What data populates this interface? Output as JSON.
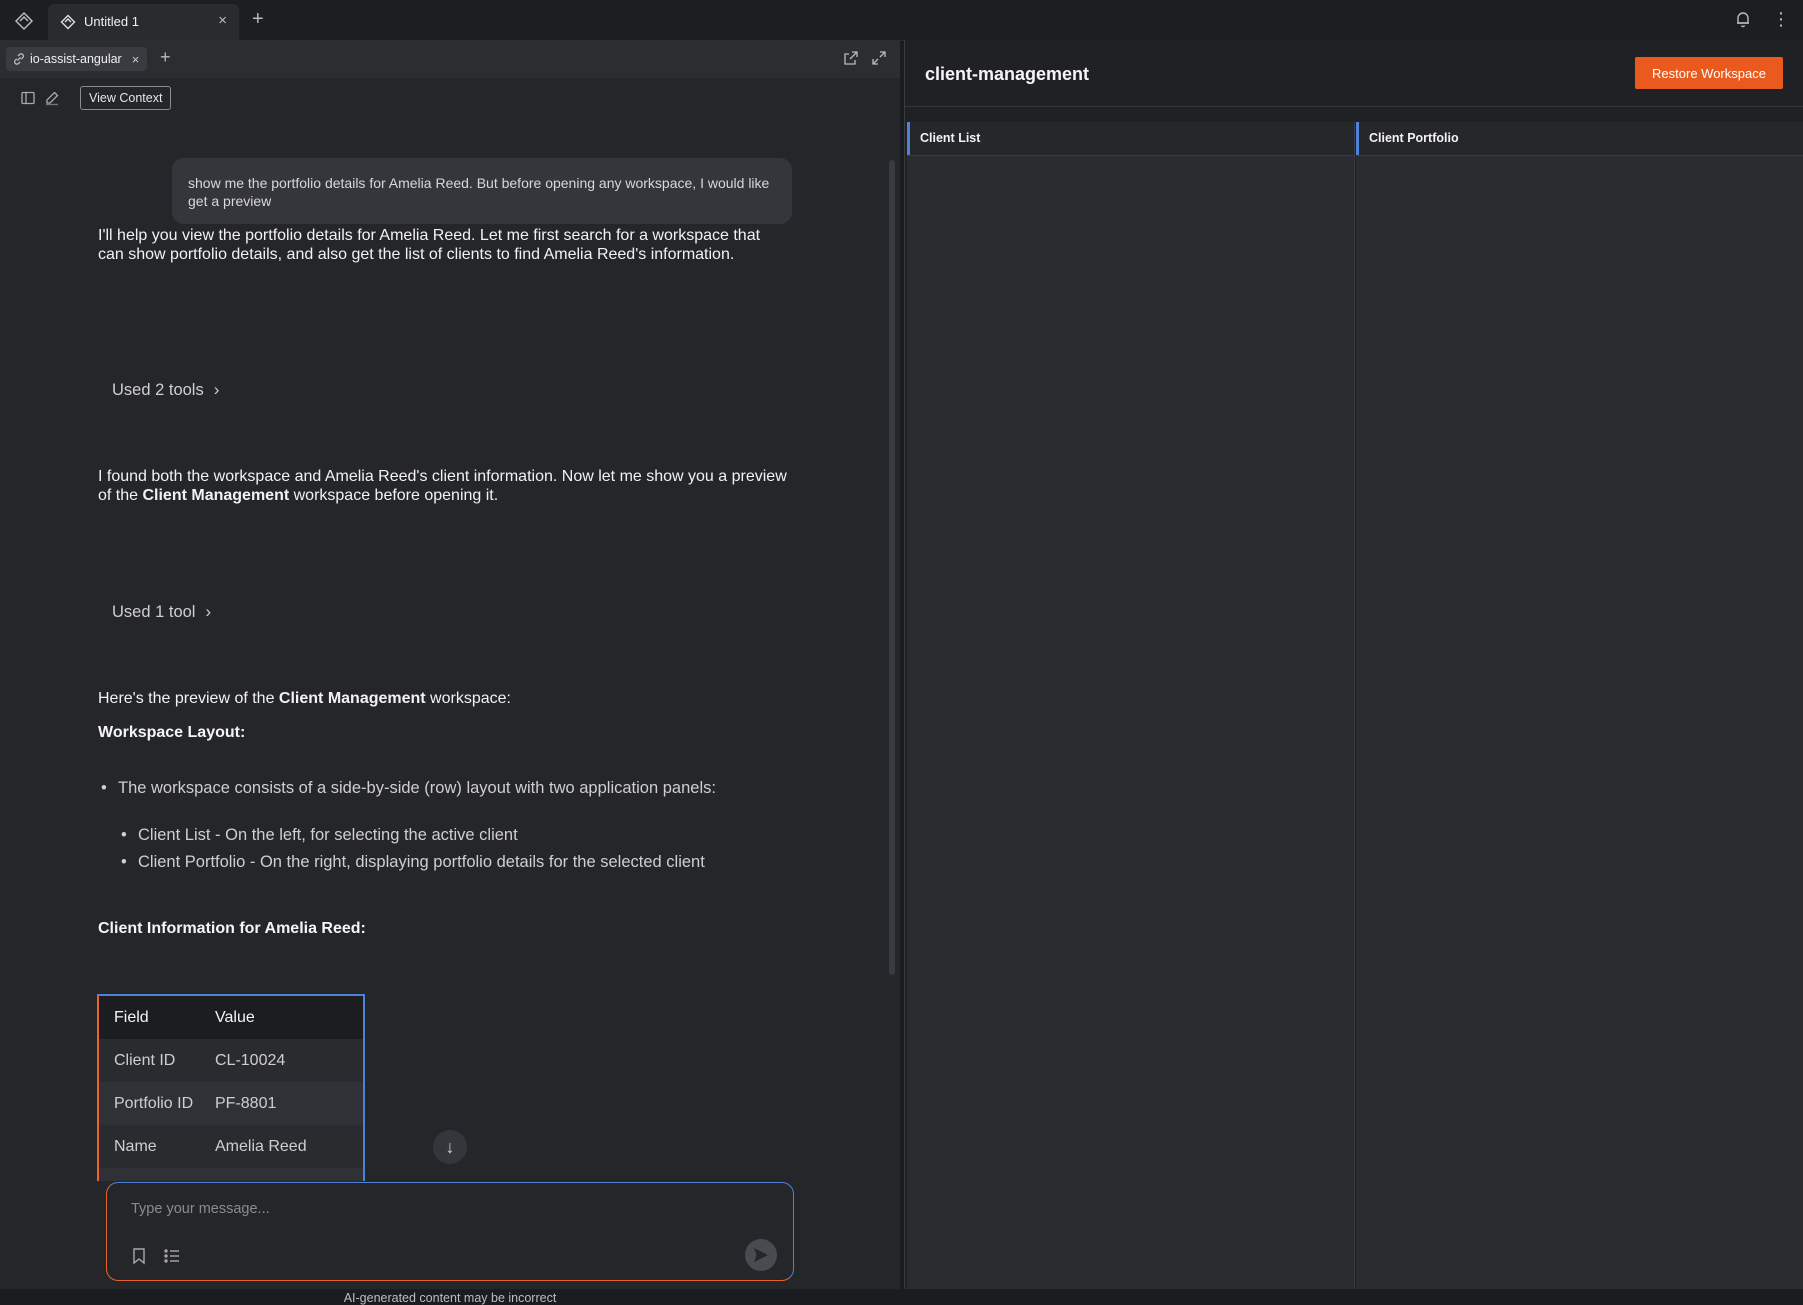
{
  "tabbar": {
    "tab_title": "Untitled 1",
    "close_glyph": "×",
    "new_tab_glyph": "+",
    "kebab_glyph": "⋮"
  },
  "chat": {
    "chip_label": "io-assist-angular",
    "chip_close": "×",
    "add_glyph": "+",
    "view_context_label": "View Context",
    "user_message": "show me the portfolio details for Amelia Reed. But before opening any workspace, I would like get a preview",
    "assistant_1": "I'll help you view the portfolio details for Amelia Reed. Let me first search for a workspace that can show portfolio details, and also get the list of clients to find Amelia Reed's information.",
    "tools_1": "Used 2 tools",
    "assistant_2_before": "I found both the workspace and Amelia Reed's client information. Now let me show you a preview of the ",
    "assistant_2_bold": "Client Management",
    "assistant_2_after": " workspace before opening it.",
    "tools_2": "Used 1 tool",
    "chevron_glyph": "›",
    "preview_before": "Here's the preview of the ",
    "preview_bold": "Client Management",
    "preview_after": " workspace:",
    "layout_heading": "Workspace Layout:",
    "bullet_main": "The workspace consists of a side-by-side (row) layout with two application panels:",
    "bullet_sub_1": "Client List - On the left, for selecting the active client",
    "bullet_sub_2": "Client Portfolio - On the right, displaying portfolio details for the selected client",
    "bullet_glyph": "•",
    "info_heading": "Client Information for Amelia Reed:",
    "table": {
      "headers": [
        "Field",
        "Value"
      ],
      "rows": [
        [
          "Client ID",
          "CL-10024"
        ],
        [
          "Portfolio ID",
          "PF-8801"
        ],
        [
          "Name",
          "Amelia Reed"
        ]
      ]
    },
    "scroll_glyph": "↓",
    "composer_placeholder": "Type your message...",
    "disclaimer": "AI-generated content may be incorrect"
  },
  "workspace": {
    "title": "client-management",
    "restore_label": "Restore Workspace",
    "panes": [
      "Client List",
      "Client Portfolio"
    ]
  },
  "colors": {
    "accent_orange": "#ea5a1f",
    "accent_blue": "#4d82d6"
  },
  "icons": [
    "app-logo-icon",
    "tab-icon",
    "bell-icon",
    "link-icon",
    "popout-icon",
    "expand-icon",
    "sidebar-toggle-icon",
    "edit-icon",
    "bookmark-icon",
    "list-icon",
    "send-icon",
    "chevron-right-icon",
    "arrow-down-icon"
  ]
}
